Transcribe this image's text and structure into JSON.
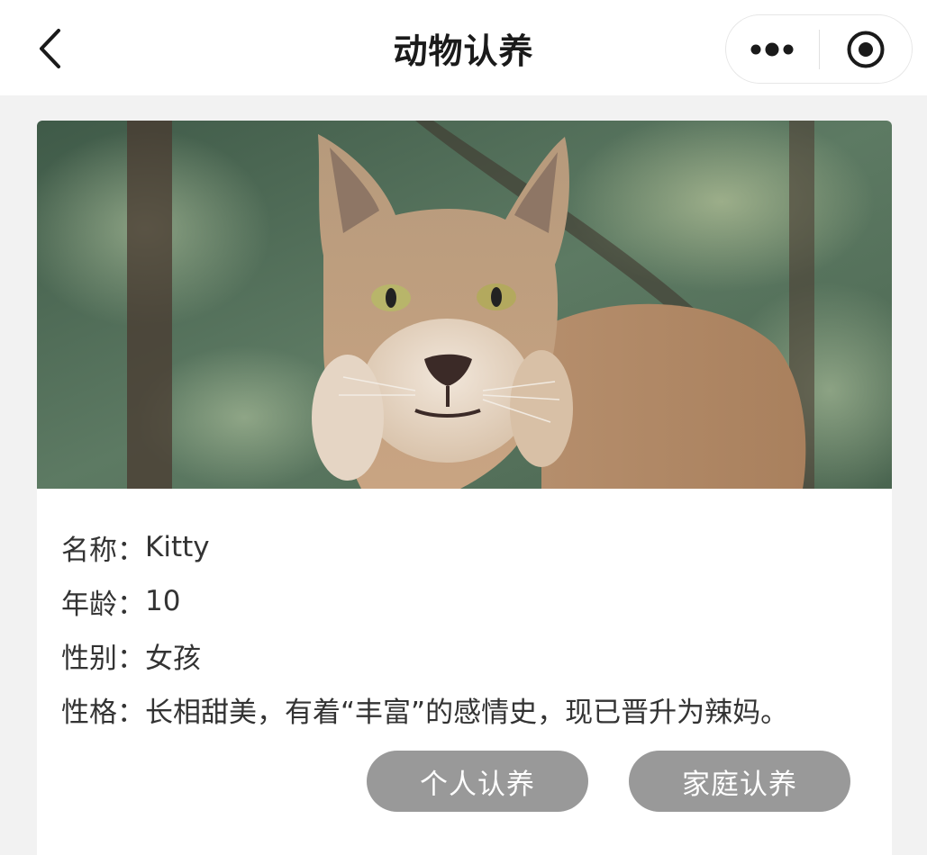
{
  "navbar": {
    "title": "动物认养",
    "back_icon": "chevron-left-icon",
    "more_icon": "more-dots-icon",
    "close_icon": "target-circle-icon"
  },
  "animal": {
    "photo_description_icon": "lynx-photo",
    "name_label": "名称：",
    "name": "Kitty",
    "age_label": "年龄：",
    "age": "10",
    "gender_label": "性别：",
    "gender": "女孩",
    "personality_label": "性格：",
    "personality": "长相甜美，有着“丰富”的感情史，现已晋升为辣妈。"
  },
  "actions": {
    "personal_adopt": "个人认养",
    "family_adopt": "家庭认养"
  },
  "colors": {
    "button_bg": "#999999",
    "page_bg": "#f2f2f2",
    "text": "#333333"
  }
}
